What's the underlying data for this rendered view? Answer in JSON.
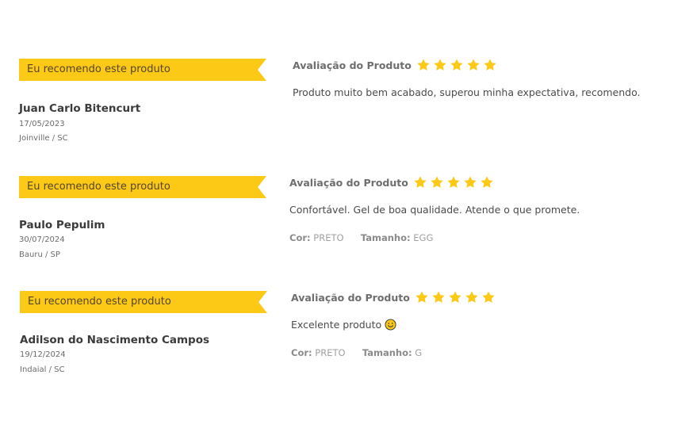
{
  "reviews": [
    {
      "recommend": "Eu recomendo este produto",
      "name": "Juan Carlo Bitencurt",
      "date": "17/05/2023",
      "location": "Joinville / SC",
      "rating_label": "Avaliação do Produto",
      "rating": 5,
      "comment": "Produto muito bem acabado, superou minha expectativa, recomendo."
    },
    {
      "recommend": "Eu recomendo este produto",
      "name": "Paulo Pepulim",
      "date": "30/07/2024",
      "location": "Bauru / SP",
      "rating_label": "Avaliação do Produto",
      "rating": 5,
      "comment": "Confortável. Gel de boa qualidade. Atende o que promete.",
      "color_label": "Cor:",
      "color_value": "PRETO",
      "size_label": "Tamanho:",
      "size_value": "EGG"
    },
    {
      "recommend": "Eu recomendo este produto",
      "name": "Adilson do Nascimento Campos",
      "date": "19/12/2024",
      "location": "Indaial / SC",
      "rating_label": "Avaliação do Produto",
      "rating": 5,
      "comment": "Excelente produto",
      "comment_icon": "smiley-face-icon",
      "color_label": "Cor:",
      "color_value": "PRETO",
      "size_label": "Tamanho:",
      "size_value": "G"
    }
  ],
  "colors": {
    "ribbon": "#fcc916",
    "star": "#fcc916"
  }
}
